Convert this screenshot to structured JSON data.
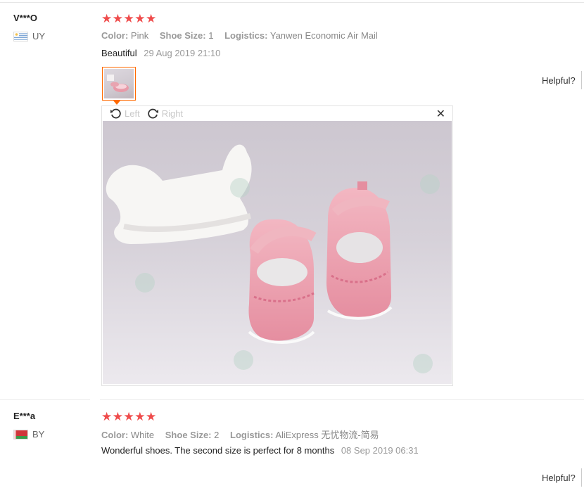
{
  "reviews": [
    {
      "user": "V***O",
      "country_code": "UY",
      "stars": "★★★★★",
      "color_label": "Color:",
      "color_value": "Pink",
      "size_label": "Shoe Size:",
      "size_value": "1",
      "logistics_label": "Logistics:",
      "logistics_value": "Yanwen Economic Air Mail",
      "feedback": "Beautiful",
      "time": "29 Aug 2019 21:10",
      "helpful_label": "Helpful?"
    },
    {
      "user": "E***a",
      "country_code": "BY",
      "stars": "★★★★★",
      "color_label": "Color:",
      "color_value": "White",
      "size_label": "Shoe Size:",
      "size_value": "2",
      "logistics_label": "Logistics:",
      "logistics_value": "AliExpress 无忧物流-简易",
      "feedback": "Wonderful shoes. The second size is perfect for 8 months",
      "time": "08 Sep 2019 06:31",
      "helpful_label": "Helpful?"
    }
  ],
  "viewer": {
    "rotate_left": "Left",
    "rotate_right": "Right",
    "close": "✕"
  },
  "icons": {
    "rotate_left": "rotate-left-icon",
    "rotate_right": "rotate-right-icon",
    "close": "close-icon"
  },
  "colors": {
    "star": "#ef4b4b",
    "accent": "#ff6a00"
  }
}
